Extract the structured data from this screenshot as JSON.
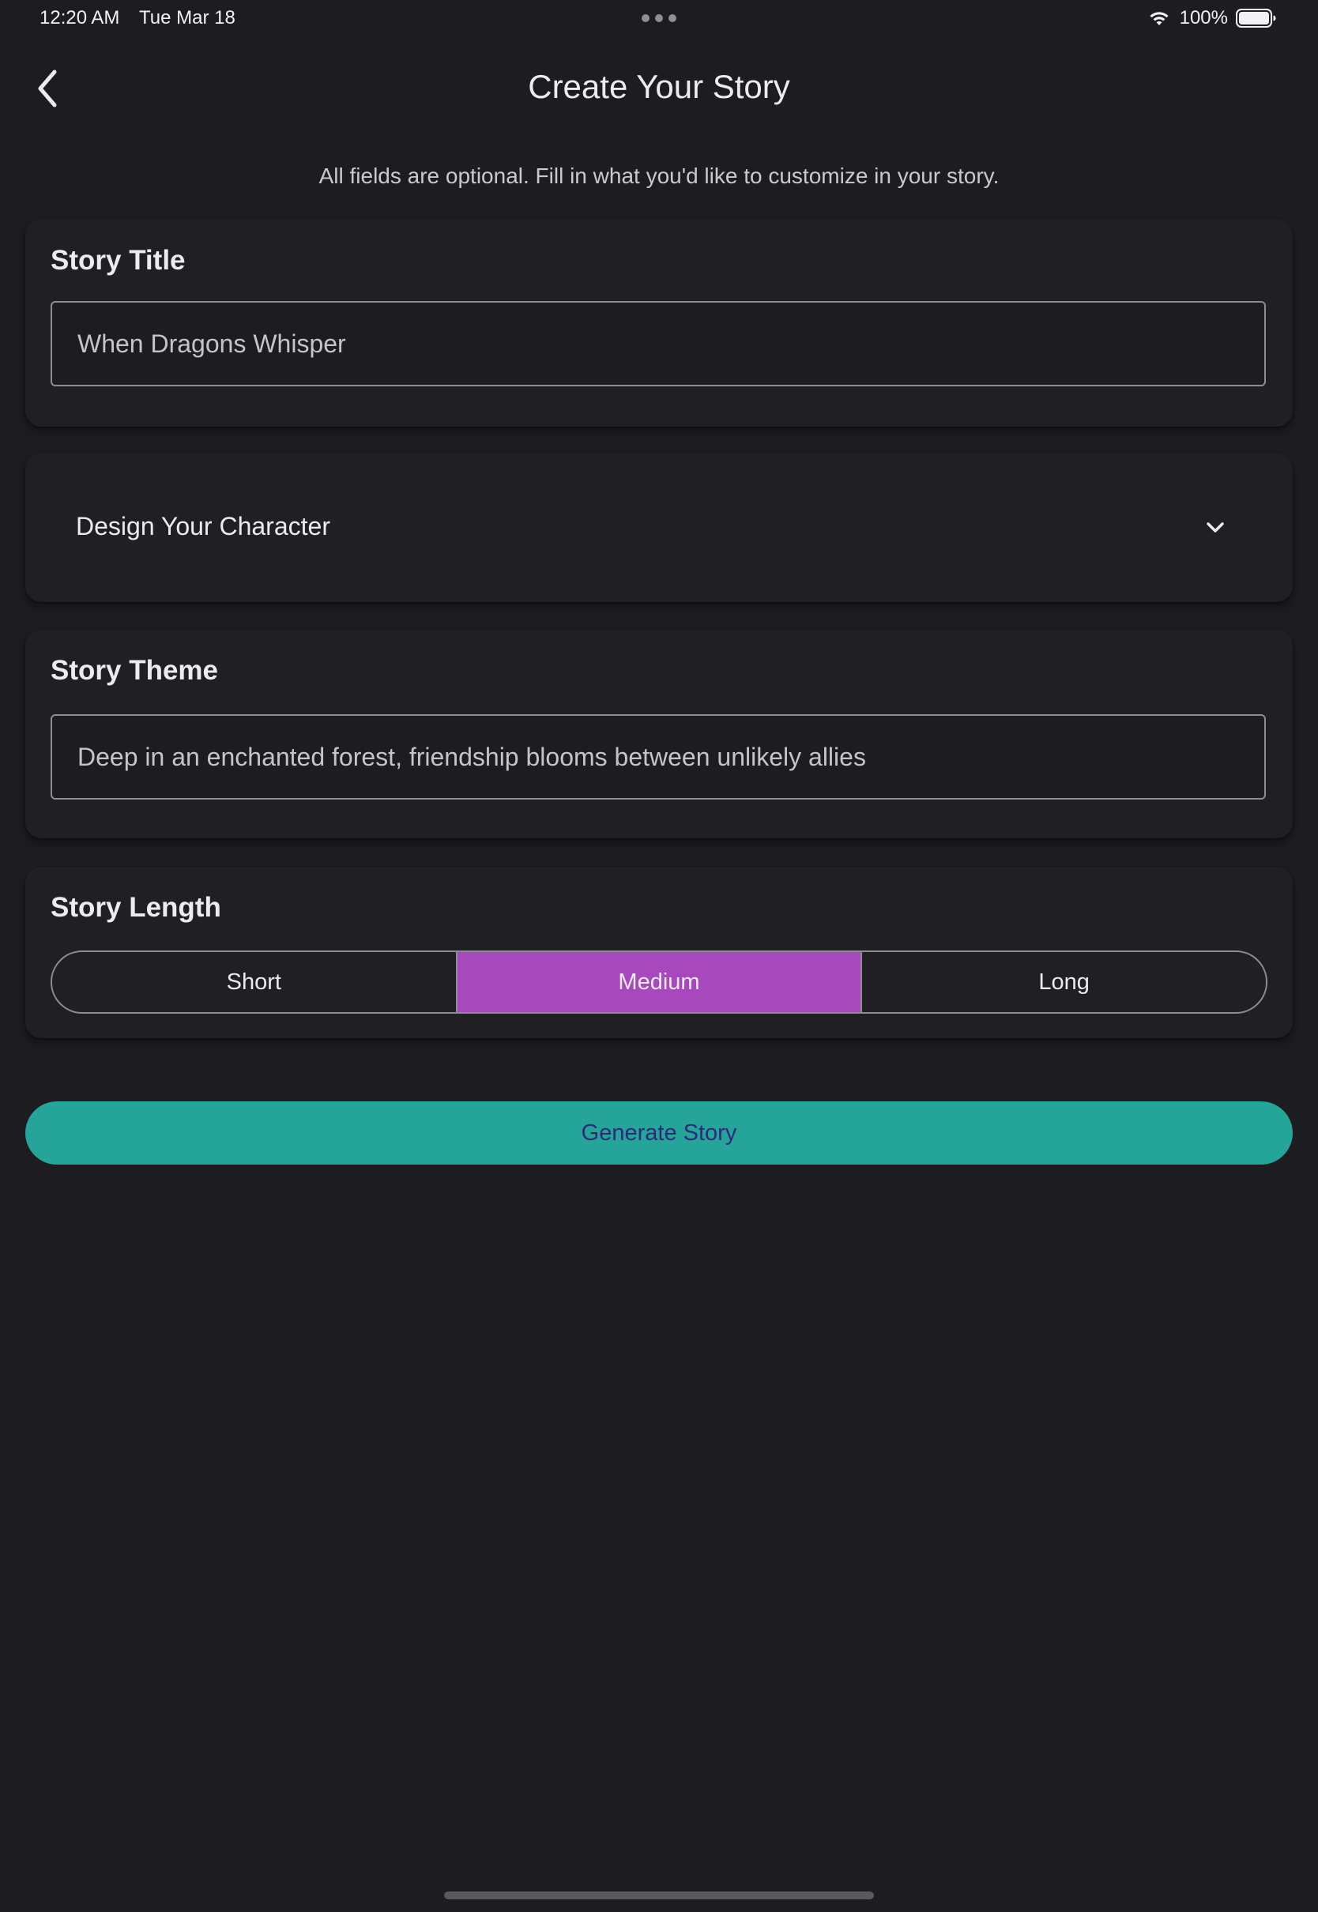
{
  "status_bar": {
    "time": "12:20 AM",
    "date": "Tue Mar 18",
    "battery": "100%",
    "icons": [
      "wifi-icon",
      "battery-icon"
    ]
  },
  "header": {
    "back_icon": "chevron-left-icon",
    "title": "Create Your Story"
  },
  "subtitle": "All fields are optional. Fill in what you'd like to customize in your story.",
  "story_title": {
    "label": "Story Title",
    "value": "When Dragons Whisper"
  },
  "character": {
    "label": "Design Your Character",
    "expand_icon": "chevron-down-icon",
    "expanded": false
  },
  "story_theme": {
    "label": "Story Theme",
    "value": "Deep in an enchanted forest, friendship blooms between unlikely allies"
  },
  "story_length": {
    "label": "Story Length",
    "options": [
      "Short",
      "Medium",
      "Long"
    ],
    "selected": "Medium"
  },
  "generate_button": {
    "label": "Generate Story"
  },
  "colors": {
    "background": "#1c1c21",
    "card": "#1f1f24",
    "selected_segment": "#a748bd",
    "generate_button": "#25a49a",
    "generate_text": "#2e2a78"
  }
}
